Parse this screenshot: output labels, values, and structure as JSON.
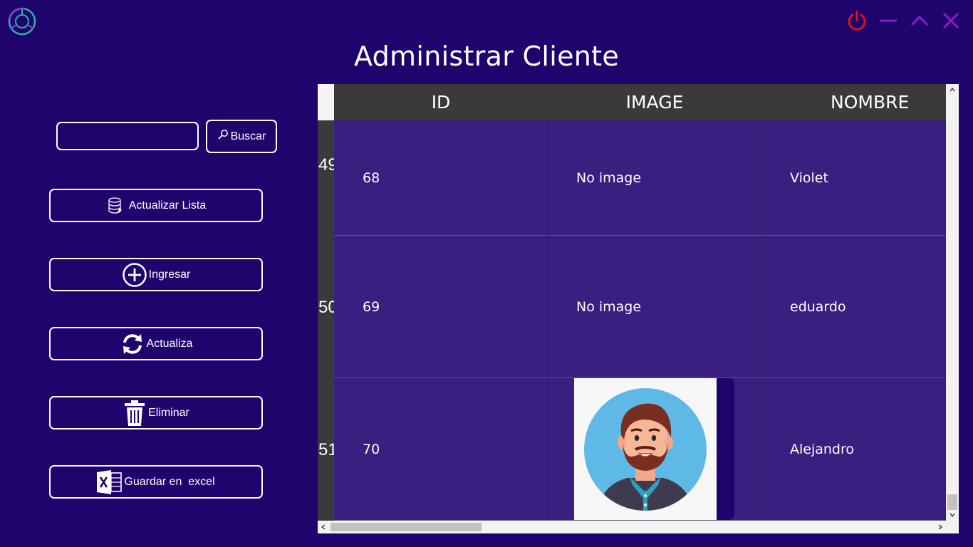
{
  "window": {
    "title": "Administrar Cliente",
    "logo_icon": "circle-logo-icon",
    "controls": [
      "power-icon",
      "minimize-icon",
      "maximize-icon",
      "close-icon"
    ],
    "colors": {
      "background": "#1f046e",
      "power": "#e0101a",
      "controls": "#8a1cc9"
    }
  },
  "search": {
    "value": "",
    "placeholder": "",
    "button_label": "Buscar",
    "button_icon": "search-icon"
  },
  "actions": [
    {
      "label": "Actualizar Lista",
      "icon": "database-icon"
    },
    {
      "label": "Ingresar",
      "icon": "plus-circle-icon"
    },
    {
      "label": "Actualiza",
      "icon": "refresh-icon"
    },
    {
      "label": "Eliminar",
      "icon": "trash-icon"
    },
    {
      "label": "Guardar en  excel",
      "icon": "excel-icon"
    }
  ],
  "grid": {
    "columns": [
      "ID",
      "IMAGE",
      "NOMBRE"
    ],
    "rows": [
      {
        "row_number": "49",
        "id": "68",
        "image": "No image",
        "nombre": "Violet"
      },
      {
        "row_number": "50",
        "id": "69",
        "image": "No image",
        "nombre": "eduardo"
      },
      {
        "row_number": "51",
        "id": "70",
        "image": "",
        "image_icon": "avatar-man-icon",
        "nombre": "Alejandro"
      }
    ],
    "colors": {
      "header": "#3a3a3a",
      "cell": "#3a1e80"
    }
  }
}
